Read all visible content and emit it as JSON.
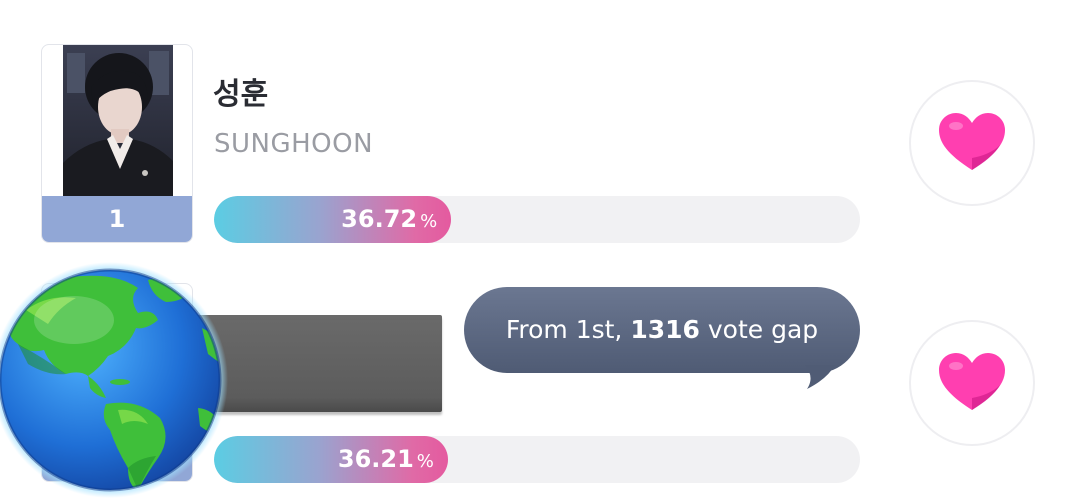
{
  "candidates": [
    {
      "rank": "1",
      "name_ko": "성훈",
      "name_en": "SUNGHOON",
      "percent": "36.72",
      "percent_value": 36.72,
      "percent_sign": "%"
    },
    {
      "rank": "",
      "percent": "36.21",
      "percent_value": 36.21,
      "percent_sign": "%"
    }
  ],
  "tooltip": {
    "prefix": "From 1st,",
    "gap": "1316",
    "suffix": "vote gap"
  },
  "icons": {
    "vote": "heart-icon",
    "overlay": "globe-icon"
  },
  "colors": {
    "heart": "#ff3fb0",
    "rank_badge": "#91a7d6",
    "bar_start": "#5bcde3",
    "bar_end": "#e45a9f",
    "bubble": "#58647d"
  }
}
